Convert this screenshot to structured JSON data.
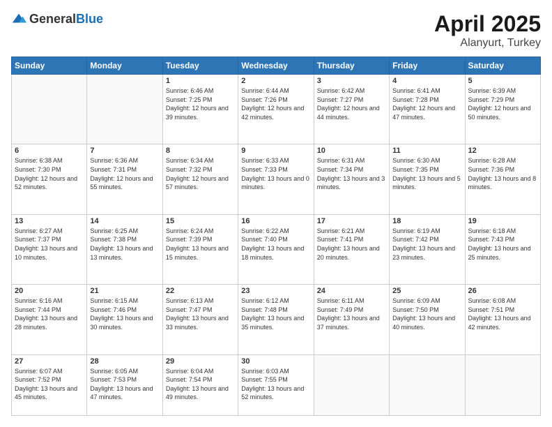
{
  "header": {
    "logo_general": "General",
    "logo_blue": "Blue",
    "title": "April 2025",
    "location": "Alanyurt, Turkey"
  },
  "weekdays": [
    "Sunday",
    "Monday",
    "Tuesday",
    "Wednesday",
    "Thursday",
    "Friday",
    "Saturday"
  ],
  "weeks": [
    [
      {
        "day": "",
        "info": ""
      },
      {
        "day": "",
        "info": ""
      },
      {
        "day": "1",
        "info": "Sunrise: 6:46 AM\nSunset: 7:25 PM\nDaylight: 12 hours and 39 minutes."
      },
      {
        "day": "2",
        "info": "Sunrise: 6:44 AM\nSunset: 7:26 PM\nDaylight: 12 hours and 42 minutes."
      },
      {
        "day": "3",
        "info": "Sunrise: 6:42 AM\nSunset: 7:27 PM\nDaylight: 12 hours and 44 minutes."
      },
      {
        "day": "4",
        "info": "Sunrise: 6:41 AM\nSunset: 7:28 PM\nDaylight: 12 hours and 47 minutes."
      },
      {
        "day": "5",
        "info": "Sunrise: 6:39 AM\nSunset: 7:29 PM\nDaylight: 12 hours and 50 minutes."
      }
    ],
    [
      {
        "day": "6",
        "info": "Sunrise: 6:38 AM\nSunset: 7:30 PM\nDaylight: 12 hours and 52 minutes."
      },
      {
        "day": "7",
        "info": "Sunrise: 6:36 AM\nSunset: 7:31 PM\nDaylight: 12 hours and 55 minutes."
      },
      {
        "day": "8",
        "info": "Sunrise: 6:34 AM\nSunset: 7:32 PM\nDaylight: 12 hours and 57 minutes."
      },
      {
        "day": "9",
        "info": "Sunrise: 6:33 AM\nSunset: 7:33 PM\nDaylight: 13 hours and 0 minutes."
      },
      {
        "day": "10",
        "info": "Sunrise: 6:31 AM\nSunset: 7:34 PM\nDaylight: 13 hours and 3 minutes."
      },
      {
        "day": "11",
        "info": "Sunrise: 6:30 AM\nSunset: 7:35 PM\nDaylight: 13 hours and 5 minutes."
      },
      {
        "day": "12",
        "info": "Sunrise: 6:28 AM\nSunset: 7:36 PM\nDaylight: 13 hours and 8 minutes."
      }
    ],
    [
      {
        "day": "13",
        "info": "Sunrise: 6:27 AM\nSunset: 7:37 PM\nDaylight: 13 hours and 10 minutes."
      },
      {
        "day": "14",
        "info": "Sunrise: 6:25 AM\nSunset: 7:38 PM\nDaylight: 13 hours and 13 minutes."
      },
      {
        "day": "15",
        "info": "Sunrise: 6:24 AM\nSunset: 7:39 PM\nDaylight: 13 hours and 15 minutes."
      },
      {
        "day": "16",
        "info": "Sunrise: 6:22 AM\nSunset: 7:40 PM\nDaylight: 13 hours and 18 minutes."
      },
      {
        "day": "17",
        "info": "Sunrise: 6:21 AM\nSunset: 7:41 PM\nDaylight: 13 hours and 20 minutes."
      },
      {
        "day": "18",
        "info": "Sunrise: 6:19 AM\nSunset: 7:42 PM\nDaylight: 13 hours and 23 minutes."
      },
      {
        "day": "19",
        "info": "Sunrise: 6:18 AM\nSunset: 7:43 PM\nDaylight: 13 hours and 25 minutes."
      }
    ],
    [
      {
        "day": "20",
        "info": "Sunrise: 6:16 AM\nSunset: 7:44 PM\nDaylight: 13 hours and 28 minutes."
      },
      {
        "day": "21",
        "info": "Sunrise: 6:15 AM\nSunset: 7:46 PM\nDaylight: 13 hours and 30 minutes."
      },
      {
        "day": "22",
        "info": "Sunrise: 6:13 AM\nSunset: 7:47 PM\nDaylight: 13 hours and 33 minutes."
      },
      {
        "day": "23",
        "info": "Sunrise: 6:12 AM\nSunset: 7:48 PM\nDaylight: 13 hours and 35 minutes."
      },
      {
        "day": "24",
        "info": "Sunrise: 6:11 AM\nSunset: 7:49 PM\nDaylight: 13 hours and 37 minutes."
      },
      {
        "day": "25",
        "info": "Sunrise: 6:09 AM\nSunset: 7:50 PM\nDaylight: 13 hours and 40 minutes."
      },
      {
        "day": "26",
        "info": "Sunrise: 6:08 AM\nSunset: 7:51 PM\nDaylight: 13 hours and 42 minutes."
      }
    ],
    [
      {
        "day": "27",
        "info": "Sunrise: 6:07 AM\nSunset: 7:52 PM\nDaylight: 13 hours and 45 minutes."
      },
      {
        "day": "28",
        "info": "Sunrise: 6:05 AM\nSunset: 7:53 PM\nDaylight: 13 hours and 47 minutes."
      },
      {
        "day": "29",
        "info": "Sunrise: 6:04 AM\nSunset: 7:54 PM\nDaylight: 13 hours and 49 minutes."
      },
      {
        "day": "30",
        "info": "Sunrise: 6:03 AM\nSunset: 7:55 PM\nDaylight: 13 hours and 52 minutes."
      },
      {
        "day": "",
        "info": ""
      },
      {
        "day": "",
        "info": ""
      },
      {
        "day": "",
        "info": ""
      }
    ]
  ]
}
